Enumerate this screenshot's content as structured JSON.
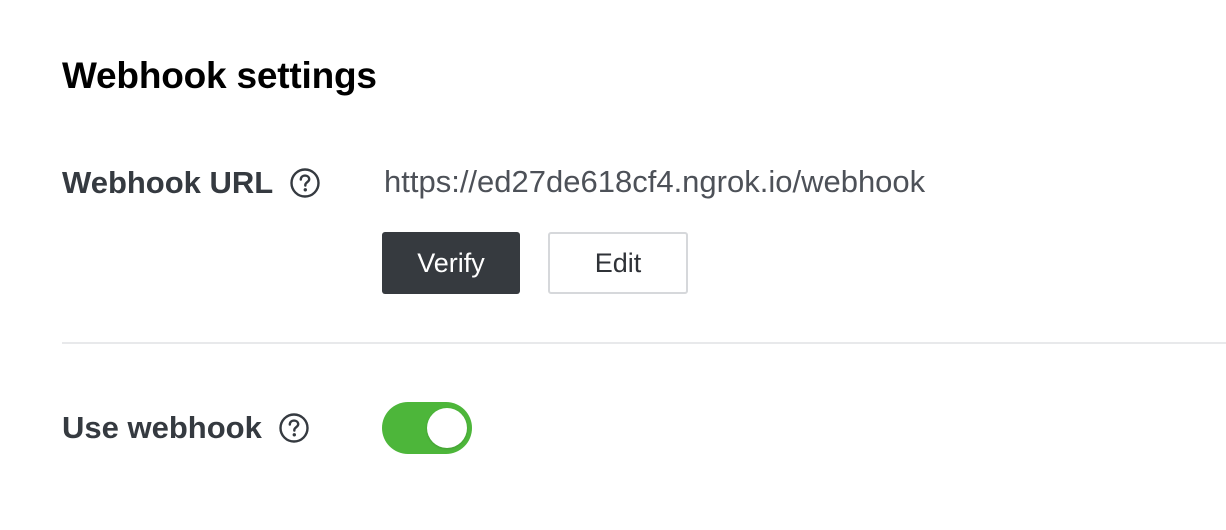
{
  "section": {
    "title": "Webhook settings"
  },
  "webhook_url": {
    "label": "Webhook URL",
    "help_icon": "question-circle-icon",
    "value": "https://ed27de618cf4.ngrok.io/webhook",
    "verify_label": "Verify",
    "edit_label": "Edit"
  },
  "use_webhook": {
    "label": "Use webhook",
    "help_icon": "question-circle-icon",
    "enabled": true
  },
  "colors": {
    "toggle_on": "#4db63a",
    "verify_button": "#363a3f",
    "edit_border": "#d6d8db",
    "divider": "#e8e9eb"
  }
}
